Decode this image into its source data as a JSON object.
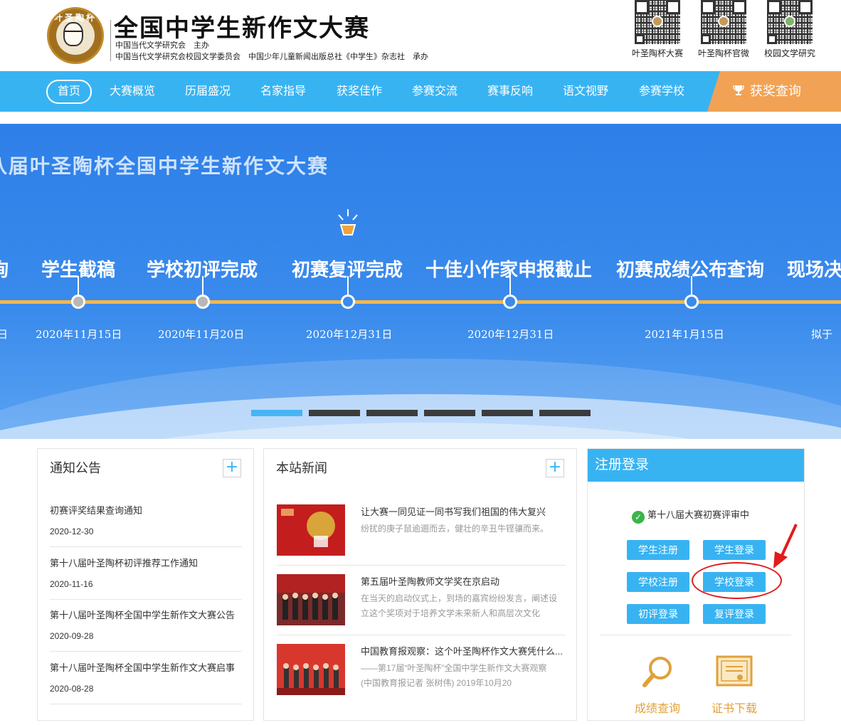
{
  "header": {
    "logo_text": "叶圣陶杯",
    "title": "全国中学生新作文大赛",
    "org_line1": "中国当代文学研究会　主办",
    "org_line2": "中国当代文学研究会校园文学委员会　中国少年儿童新闻出版总社《中学生》杂志社　承办",
    "qr_codes": [
      {
        "label": "叶圣陶杯大赛"
      },
      {
        "label": "叶圣陶杯官微"
      },
      {
        "label": "校园文学研究"
      }
    ]
  },
  "nav": {
    "items": [
      "首页",
      "大赛概览",
      "历届盛况",
      "名家指导",
      "获奖佳作",
      "参赛交流",
      "赛事反响",
      "语文视野",
      "参赛学校"
    ],
    "active": "首页",
    "award_query": "获奖查询",
    "colors": {
      "nav_bg": "#38b3f2",
      "award_bg": "#f2a254"
    }
  },
  "banner": {
    "title": "八届叶圣陶杯全国中学生新作文大赛",
    "timeline": [
      {
        "label": "询",
        "date": "日",
        "state": "done"
      },
      {
        "label": "学生截稿",
        "date": "2020年11月15日",
        "state": "done"
      },
      {
        "label": "学校初评完成",
        "date": "2020年11月20日",
        "state": "done"
      },
      {
        "label": "初赛复评完成",
        "date": "2020年12月31日",
        "state": "current"
      },
      {
        "label": "十佳小作家申报截止",
        "date": "2020年12月31日",
        "state": "upcoming"
      },
      {
        "label": "初赛成绩公布查询",
        "date": "2021年1月15日",
        "state": "upcoming"
      },
      {
        "label": "现场决",
        "date": "拟于",
        "state": "upcoming"
      }
    ],
    "slides": 6,
    "active_slide": 1
  },
  "notices": {
    "title": "通知公告",
    "more": "+",
    "items": [
      {
        "title": "初赛评奖结果查询通知",
        "date": "2020-12-30"
      },
      {
        "title": "第十八届叶圣陶杯初评推荐工作通知",
        "date": "2020-11-16"
      },
      {
        "title": "第十八届叶圣陶杯全国中学生新作文大赛公告",
        "date": "2020-09-28"
      },
      {
        "title": "第十八届叶圣陶杯全国中学生新作文大赛启事",
        "date": "2020-08-28"
      }
    ]
  },
  "news": {
    "title": "本站新闻",
    "more": "+",
    "items": [
      {
        "title": "让大赛一同见证一同书写我们祖国的伟大复兴",
        "desc": "纷扰的庚子鼠逾逦而去，健壮的辛丑牛铿骧而来。"
      },
      {
        "title": "第五届叶圣陶教师文学奖在京启动",
        "desc": "在当天的启动仪式上，到场的嘉宾纷纷发言，阐述设立这个奖项对于培养文学未来新人和高层次文化"
      },
      {
        "title": "中国教育报观察：这个叶圣陶杯作文大赛凭什么...",
        "desc": "——第17届“叶圣陶杯”全国中学生新作文大赛观察　(中国教育报记者 张树伟) 2019年10月20"
      }
    ]
  },
  "login": {
    "title": "注册登录",
    "status": "第十八届大赛初赛评审中",
    "buttons": {
      "student_register": "学生注册",
      "student_login": "学生登录",
      "school_register": "学校注册",
      "school_login": "学校登录",
      "initial_review_login": "初评登录",
      "second_review_login": "复评登录"
    },
    "tools": {
      "score_query": "成绩查询",
      "certificate_download": "证书下载"
    }
  }
}
